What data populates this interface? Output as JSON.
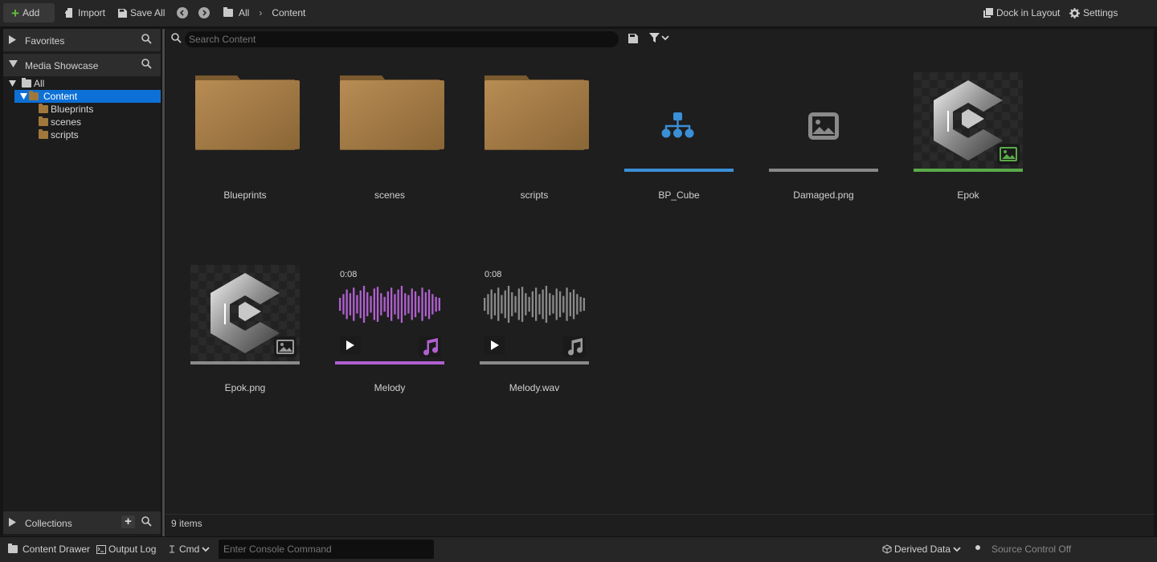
{
  "toolbar": {
    "add_label": "Add",
    "import_label": "Import",
    "save_all_label": "Save All",
    "breadcrumb_root": "All",
    "breadcrumb_current": "Content",
    "dock_label": "Dock in Layout",
    "settings_label": "Settings"
  },
  "sidebar": {
    "favorites": "Favorites",
    "media_showcase": "Media Showcase",
    "tree": {
      "root": "All",
      "content": "Content",
      "children": [
        "Blueprints",
        "scenes",
        "scripts"
      ]
    },
    "collections": "Collections"
  },
  "search": {
    "placeholder": "Search Content"
  },
  "assets": [
    {
      "name": "Blueprints",
      "kind": "folder"
    },
    {
      "name": "scenes",
      "kind": "folder"
    },
    {
      "name": "scripts",
      "kind": "folder"
    },
    {
      "name": "BP_Cube",
      "kind": "blueprint",
      "color": "#3a8fd6"
    },
    {
      "name": "Damaged.png",
      "kind": "texture-missing",
      "color": "#888888"
    },
    {
      "name": "Epok",
      "kind": "texture",
      "color": "#5aaa4a"
    },
    {
      "name": "Epok.png",
      "kind": "texture",
      "color": "#8a8a8a"
    },
    {
      "name": "Melody",
      "kind": "sound",
      "duration": "0:08",
      "color": "#b060d0"
    },
    {
      "name": "Melody.wav",
      "kind": "sound",
      "duration": "0:08",
      "color": "#8a8a8a"
    }
  ],
  "status": {
    "item_count": "9 items"
  },
  "bottombar": {
    "content_drawer": "Content Drawer",
    "output_log": "Output Log",
    "cmd": "Cmd",
    "console_placeholder": "Enter Console Command",
    "derived_data": "Derived Data",
    "source_control": "Source Control Off"
  },
  "colors": {
    "accent": "#0d70d6",
    "folder": "#a0783c",
    "add_plus": "#5fbf3f"
  }
}
